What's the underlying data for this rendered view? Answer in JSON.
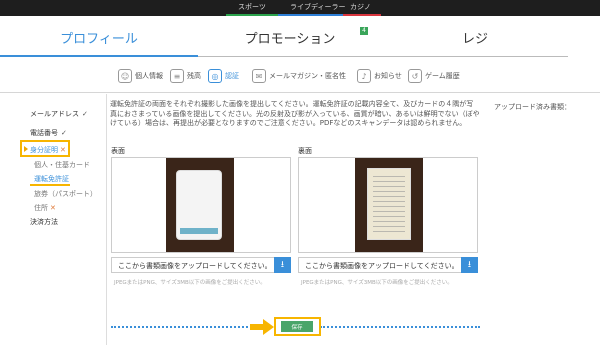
{
  "topnav": {
    "items": [
      {
        "label": "スポーツ",
        "color": "#2ba24c"
      },
      {
        "label": "ライブディーラー",
        "color": "#2e7fd6"
      },
      {
        "label": "カジノ",
        "color": "#d9363e"
      }
    ]
  },
  "tabs": {
    "profile": "プロフィール",
    "promotion": "プロモーション",
    "promotion_badge": "4",
    "register": "レジ",
    "accent_color": "#3a8fd9"
  },
  "subnav": {
    "personal": "個人情報",
    "notes": "残高",
    "verify": "認証",
    "mail": "メールマガジン・匿名性",
    "notice": "お知らせ",
    "history": "ゲーム履歴"
  },
  "sidebar": {
    "email": "メールアドレス",
    "phone": "電話番号",
    "identity": "身分証明",
    "address_card": "個人・住基カード",
    "license": "運転免許証",
    "passport": "旅券（パスポート）",
    "residence": "住所",
    "payment": "決済方法",
    "check_mark": "✓",
    "cross_mark": "✕"
  },
  "instructions": "運転免許証の両面をそれぞれ撮影した画像を提出してください。運転免許証の記載内容全て、及びカードの４隅が写真におさまっている画像を提出してください。光の反射及び影が入っている、画質が暗い、あるいは鮮明でない（ぼやけている）場合は、再提出が必要となりますのでご注意ください。PDFなどのスキャンデータは認められません。",
  "upload_status_label": "アップロード済み書類：",
  "front": {
    "label": "表面",
    "upload_text": "ここから書類画像をアップロードしてください。",
    "hint": "JPEGまたはPNG、サイズ3MB以下の画像をご提出ください。"
  },
  "back": {
    "label": "裏面",
    "upload_text": "ここから書類画像をアップロードしてください。",
    "hint": "JPEGまたはPNG、サイズ3MB以下の画像をご提出ください。"
  },
  "save_label": "保存",
  "upload_icon": "download-arrow-icon",
  "highlight_color": "#f7b500"
}
